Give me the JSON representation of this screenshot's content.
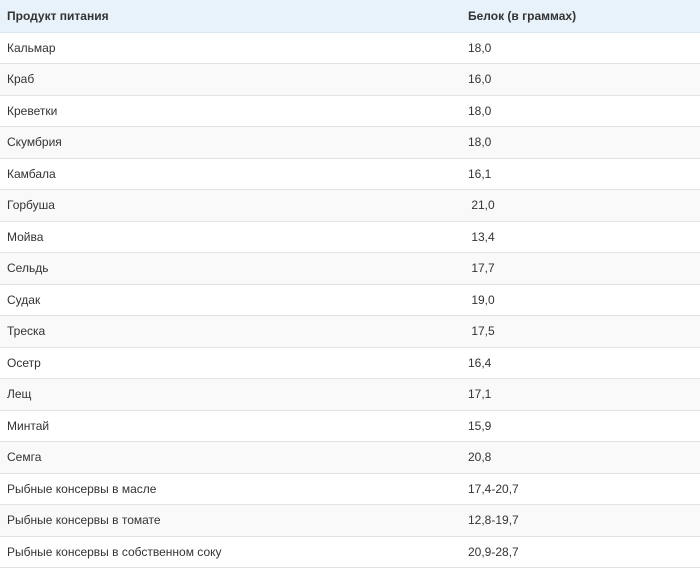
{
  "table": {
    "headers": {
      "product": "Продукт питания",
      "protein": "Белок (в граммах)"
    },
    "rows": [
      {
        "product": "Кальмар",
        "protein": "18,0"
      },
      {
        "product": "Краб",
        "protein": "16,0"
      },
      {
        "product": "Креветки",
        "protein": "18,0"
      },
      {
        "product": "Скумбрия",
        "protein": "18,0"
      },
      {
        "product": "Камбала",
        "protein": "16,1"
      },
      {
        "product": "Горбуша",
        "protein": " 21,0"
      },
      {
        "product": "Мойва",
        "protein": " 13,4"
      },
      {
        "product": "Сельдь",
        "protein": " 17,7"
      },
      {
        "product": "Судак",
        "protein": " 19,0"
      },
      {
        "product": "Треска",
        "protein": " 17,5"
      },
      {
        "product": "Осетр",
        "protein": "16,4"
      },
      {
        "product": "Лещ",
        "protein": "17,1"
      },
      {
        "product": "Минтай",
        "protein": "15,9"
      },
      {
        "product": "Семга",
        "protein": "20,8"
      },
      {
        "product": "Рыбные консервы в масле",
        "protein": "17,4-20,7"
      },
      {
        "product": "Рыбные консервы в томате",
        "protein": "12,8-19,7"
      },
      {
        "product": "Рыбные консервы в собственном соку",
        "protein": "20,9-28,7"
      }
    ]
  },
  "colors": {
    "header_bg": "#e8f2fa",
    "row_alt_bg": "#f9f9f9",
    "border": "#e3e3e3",
    "text": "#333333"
  }
}
